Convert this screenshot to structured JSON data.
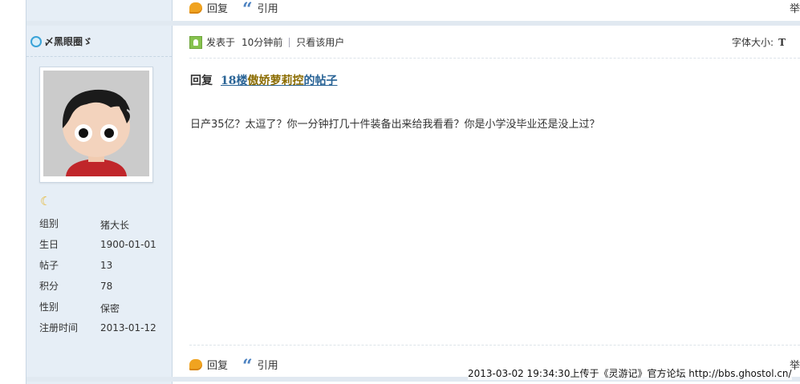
{
  "actions": {
    "reply": "回复",
    "quote": "引用",
    "report": "举"
  },
  "user": {
    "name": "〆黑眼圈ゞ",
    "profile": [
      {
        "label": "组别",
        "value": "猪大长"
      },
      {
        "label": "生日",
        "value": "1900-01-01"
      },
      {
        "label": "帖子",
        "value": "13"
      },
      {
        "label": "积分",
        "value": "78"
      },
      {
        "label": "性别",
        "value": "保密"
      },
      {
        "label": "注册时间",
        "value": "2013-01-12"
      }
    ]
  },
  "post": {
    "posted_label": "发表于",
    "time": "10分钟前",
    "only_user": "只看该用户",
    "font_size_label": "字体大小:",
    "font_size_button": "T",
    "title_prefix": "回复",
    "title_link_floor": "18楼",
    "title_link_name": "傲娇萝莉控",
    "title_link_suffix": "的帖子",
    "body": "日产35亿？太逗了？你一分钟打几十件装备出来给我看看？你是小学没毕业还是没上过？"
  },
  "watermark": "2013-03-02 19:34:30上传于《灵游记》官方论坛 http://bbs.ghostol.cn/"
}
